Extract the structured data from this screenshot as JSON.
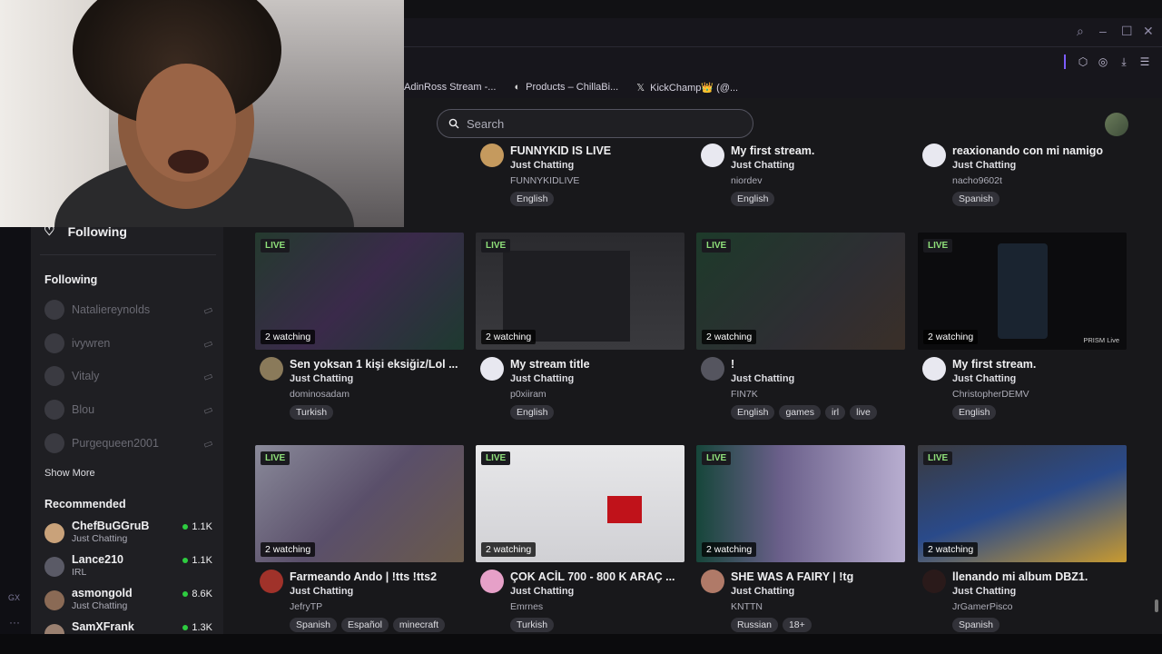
{
  "browser": {
    "bookmarks": [
      {
        "label": "AdinRoss Stream -..."
      },
      {
        "label": "Products – ChillaBi..."
      },
      {
        "label": "KickChamp👑 (@..."
      }
    ],
    "gx_label": "GX",
    "gx_more": "···"
  },
  "search": {
    "placeholder": "Search"
  },
  "sidebar": {
    "header": "Following",
    "following_title": "Following",
    "following": [
      {
        "name": "Nataliereynolds"
      },
      {
        "name": "ivywren"
      },
      {
        "name": "Vitaly"
      },
      {
        "name": "Blou"
      },
      {
        "name": "Purgequeen2001"
      }
    ],
    "show_more": "Show More",
    "recommended_title": "Recommended",
    "recommended": [
      {
        "name": "ChefBuGGruB",
        "category": "Just Chatting",
        "viewers": "1.1K"
      },
      {
        "name": "Lance210",
        "category": "IRL",
        "viewers": "1.1K"
      },
      {
        "name": "asmongold",
        "category": "Just Chatting",
        "viewers": "8.6K"
      },
      {
        "name": "SamXFrank",
        "category": "",
        "viewers": "1.3K"
      }
    ]
  },
  "row_top": [
    {
      "title": "FUNNYKID IS LIVE",
      "category": "Just Chatting",
      "channel": "FUNNYKIDLIVE",
      "tags": [
        "English"
      ]
    },
    {
      "title": "My first stream.",
      "category": "Just Chatting",
      "channel": "niordev",
      "tags": [
        "English"
      ]
    },
    {
      "title": "reaxionando con mi namigo",
      "category": "Just Chatting",
      "channel": "nacho9602t",
      "tags": [
        "Spanish"
      ]
    }
  ],
  "row_mid": [
    {
      "live": "LIVE",
      "watching": "2 watching",
      "title": "Sen yoksan 1 kişi eksiğiz/Lol ...",
      "category": "Just Chatting",
      "channel": "dominosadam",
      "tags": [
        "Turkish"
      ]
    },
    {
      "live": "LIVE",
      "watching": "2 watching",
      "title": "My stream title",
      "category": "Just Chatting",
      "channel": "p0xiiram",
      "tags": [
        "English"
      ]
    },
    {
      "live": "LIVE",
      "watching": "2 watching",
      "title": "!",
      "category": "Just Chatting",
      "channel": "FIN7K",
      "tags": [
        "English",
        "games",
        "irl",
        "live"
      ]
    },
    {
      "live": "LIVE",
      "watching": "2 watching",
      "title": "My first stream.",
      "category": "Just Chatting",
      "channel": "ChristopherDEMV",
      "tags": [
        "English"
      ],
      "overlay": "PRISM Live"
    }
  ],
  "row_bot": [
    {
      "live": "LIVE",
      "watching": "2 watching",
      "title": "Farmeando Ando | !tts !tts2",
      "category": "Just Chatting",
      "channel": "JefryTP",
      "tags": [
        "Spanish",
        "Español",
        "minecraft"
      ]
    },
    {
      "live": "LIVE",
      "watching": "2 watching",
      "title": "ÇOK ACİL 700 - 800 K ARAÇ ...",
      "category": "Just Chatting",
      "channel": "Emrnes",
      "tags": [
        "Turkish"
      ]
    },
    {
      "live": "LIVE",
      "watching": "2 watching",
      "title": "SHE WAS A FAIRY | !tg",
      "category": "Just Chatting",
      "channel": "KNTTN",
      "tags": [
        "Russian",
        "18+"
      ]
    },
    {
      "live": "LIVE",
      "watching": "2 watching",
      "title": "llenando mi album DBZ1.",
      "category": "Just Chatting",
      "channel": "JrGamerPisco",
      "tags": [
        "Spanish"
      ]
    }
  ],
  "colors": {
    "accent": "#9147ff",
    "live_green": "#8fe07a",
    "online_dot": "#2ecc40",
    "bg": "#18181b"
  }
}
